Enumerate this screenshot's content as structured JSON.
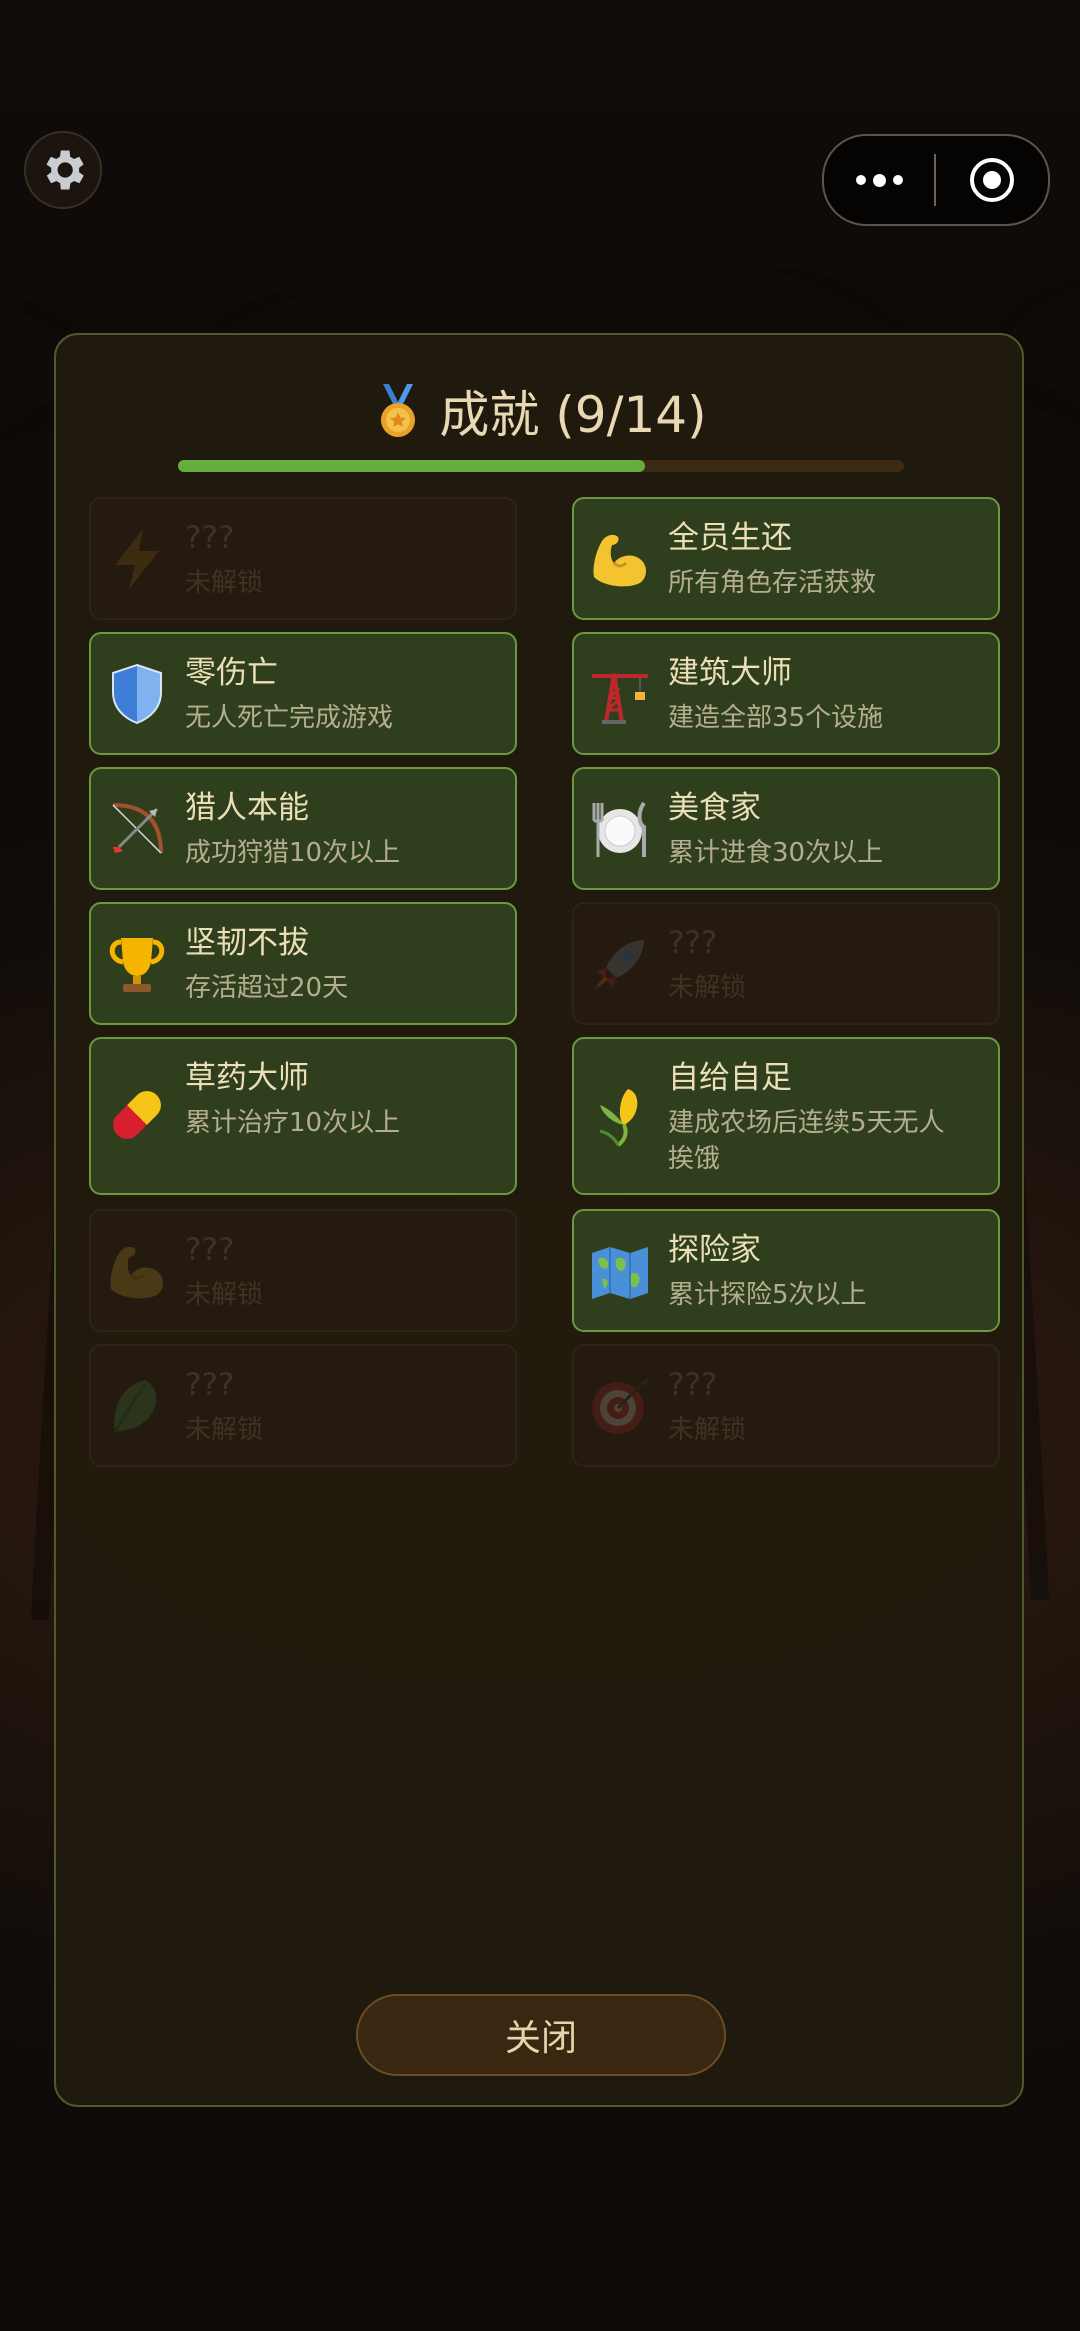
{
  "header": {
    "title": "成就 (9/14)",
    "progress_fraction": 0.643
  },
  "achievements": [
    {
      "name": "???",
      "desc": "未解锁",
      "locked": true,
      "icon": "lightning-icon"
    },
    {
      "name": "全员生还",
      "desc": "所有角色存活获救",
      "locked": false,
      "icon": "flexed-biceps-icon"
    },
    {
      "name": "零伤亡",
      "desc": "无人死亡完成游戏",
      "locked": false,
      "icon": "shield-icon"
    },
    {
      "name": "建筑大师",
      "desc": "建造全部35个设施",
      "locked": false,
      "icon": "crane-icon"
    },
    {
      "name": "猎人本能",
      "desc": "成功狩猎10次以上",
      "locked": false,
      "icon": "bow-and-arrow-icon"
    },
    {
      "name": "美食家",
      "desc": "累计进食30次以上",
      "locked": false,
      "icon": "plate-cutlery-icon"
    },
    {
      "name": "坚韧不拔",
      "desc": "存活超过20天",
      "locked": false,
      "icon": "trophy-icon"
    },
    {
      "name": "???",
      "desc": "未解锁",
      "locked": true,
      "icon": "rocket-icon"
    },
    {
      "name": "草药大师",
      "desc": "累计治疗10次以上",
      "locked": false,
      "icon": "pill-icon"
    },
    {
      "name": "自给自足",
      "desc": "建成农场后连续5天无人挨饿",
      "desc_lines": [
        "建成农场后连续5天无人",
        "挨饿"
      ],
      "locked": false,
      "icon": "corn-icon"
    },
    {
      "name": "???",
      "desc": "未解锁",
      "locked": true,
      "icon": "flexed-biceps-icon"
    },
    {
      "name": "探险家",
      "desc": "累计探险5次以上",
      "locked": false,
      "icon": "world-map-icon"
    },
    {
      "name": "???",
      "desc": "未解锁",
      "locked": true,
      "icon": "leafy-green-icon"
    },
    {
      "name": "???",
      "desc": "未解锁",
      "locked": true,
      "icon": "target-icon"
    }
  ],
  "footer": {
    "close_label": "关闭"
  },
  "colors": {
    "progress": "#67ad3e",
    "card_unlocked_bg": "#2f3f1d",
    "card_unlocked_border": "#6b9940",
    "panel_border": "#4f5a2c"
  }
}
